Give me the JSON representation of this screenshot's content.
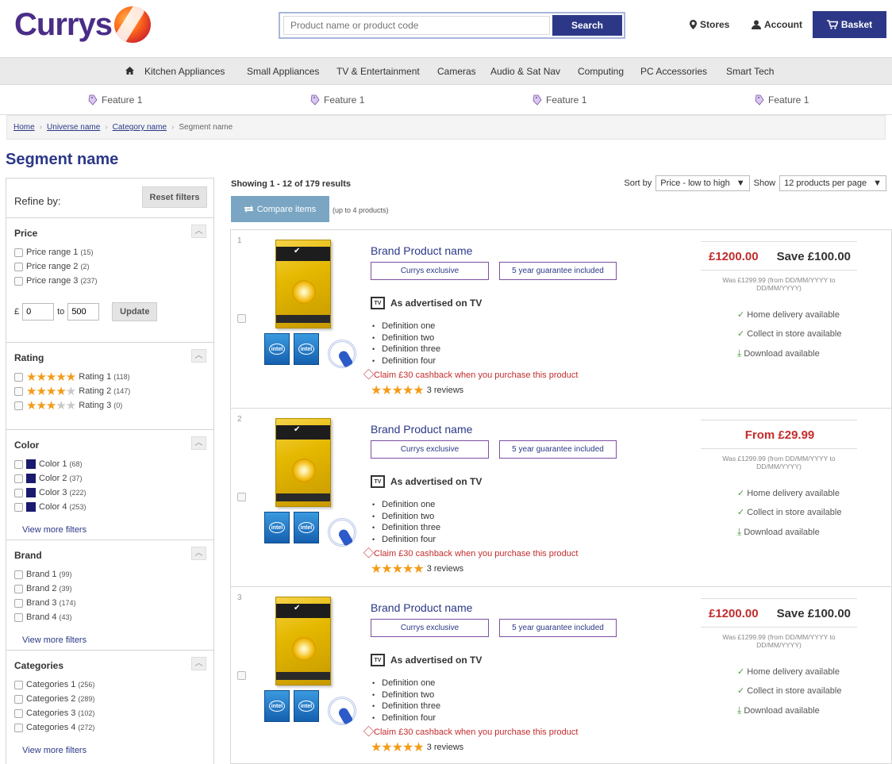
{
  "header": {
    "logo": "Currys",
    "search_placeholder": "Product name or product code",
    "search_button": "Search",
    "stores": "Stores",
    "account": "Account",
    "basket": "Basket"
  },
  "nav": [
    "Kitchen Appliances",
    "Small Appliances",
    "TV & Entertainment",
    "Cameras",
    "Audio & Sat Nav",
    "Computing",
    "PC Accessories",
    "Smart Tech"
  ],
  "features": [
    "Feature 1",
    "Feature 1",
    "Feature 1",
    "Feature 1"
  ],
  "breadcrumb": [
    "Home",
    "Universe name",
    "Category name",
    "Segment name"
  ],
  "page_title": "Segment name",
  "sidebar": {
    "refine_label": "Refine by:",
    "reset_label": "Reset filters",
    "price": {
      "title": "Price",
      "options": [
        {
          "label": "Price range 1",
          "count": "(15)"
        },
        {
          "label": "Price range 2",
          "count": "(2)"
        },
        {
          "label": "Price range 3",
          "count": "(237)"
        }
      ],
      "currency": "£",
      "min": "0",
      "to": "to",
      "max": "500",
      "update": "Update"
    },
    "rating": {
      "title": "Rating",
      "options": [
        {
          "label": "Rating 1",
          "count": "(118)",
          "stars": 5
        },
        {
          "label": "Rating 2",
          "count": "(147)",
          "stars": 4
        },
        {
          "label": "Rating 3",
          "count": "(0)",
          "stars": 3
        }
      ]
    },
    "color": {
      "title": "Color",
      "swatch": "#1a1a6e",
      "options": [
        {
          "label": "Color 1",
          "count": "(68)"
        },
        {
          "label": "Color 2",
          "count": "(37)"
        },
        {
          "label": "Color 3",
          "count": "(222)"
        },
        {
          "label": "Color 4",
          "count": "(253)"
        }
      ],
      "view_more": "View more filters"
    },
    "brand": {
      "title": "Brand",
      "options": [
        {
          "label": "Brand 1",
          "count": "(99)"
        },
        {
          "label": "Brand 2",
          "count": "(39)"
        },
        {
          "label": "Brand 3",
          "count": "(174)"
        },
        {
          "label": "Brand 4",
          "count": "(43)"
        }
      ],
      "view_more": "View more filters"
    },
    "categories": {
      "title": "Categories",
      "options": [
        {
          "label": "Categories 1",
          "count": "(256)"
        },
        {
          "label": "Categories 2",
          "count": "(289)"
        },
        {
          "label": "Categories 3",
          "count": "(102)"
        },
        {
          "label": "Categories 4",
          "count": "(272)"
        }
      ],
      "view_more": "View more filters"
    }
  },
  "results": {
    "showing": "Showing 1 - 12 of 179 results",
    "sort_label": "Sort by",
    "sort_value": "Price - low to high",
    "show_label": "Show",
    "show_value": "12 products per page",
    "compare_button": "Compare items",
    "compare_note": "(up to 4 products)"
  },
  "products": [
    {
      "num": "1",
      "name": "Brand Product name",
      "tag1": "Currys exclusive",
      "tag2": "5 year guarantee included",
      "tv": "As advertised on TV",
      "definitions": [
        "Definition one",
        "Definition two",
        "Definition three",
        "Definition four"
      ],
      "cashback": "Claim £30 cashback when you purchase this product",
      "reviews": "3 reviews",
      "price": "£1200.00",
      "save": "Save £100.00",
      "was": "Was £1299.99 (from DD/MM/YYYY to DD/MM/YYYY)",
      "home_delivery": "Home delivery available",
      "collect": "Collect in store available",
      "download": "Download available"
    },
    {
      "num": "2",
      "name": "Brand Product name",
      "tag1": "Currys exclusive",
      "tag2": "5 year guarantee included",
      "tv": "As advertised on TV",
      "definitions": [
        "Definition one",
        "Definition two",
        "Definition three",
        "Definition four"
      ],
      "cashback": "Claim £30 cashback when you purchase this product",
      "reviews": "3 reviews",
      "price": "From £29.99",
      "save": "",
      "was": "Was £1299.99 (from DD/MM/YYYY to DD/MM/YYYY)",
      "home_delivery": "Home delivery available",
      "collect": "Collect in store available",
      "download": "Download available"
    },
    {
      "num": "3",
      "name": "Brand Product name",
      "tag1": "Currys exclusive",
      "tag2": "5 year guarantee included",
      "tv": "As advertised on TV",
      "definitions": [
        "Definition one",
        "Definition two",
        "Definition three",
        "Definition four"
      ],
      "cashback": "Claim £30 cashback when you purchase this product",
      "reviews": "3 reviews",
      "price": "£1200.00",
      "save": "Save £100.00",
      "was": "Was £1299.99 (from DD/MM/YYYY to DD/MM/YYYY)",
      "home_delivery": "Home delivery available",
      "collect": "Collect in store available",
      "download": "Download available"
    }
  ],
  "colors": {
    "brand": "#2c3887",
    "price_red": "#c32c2c",
    "star": "#f39c1a"
  }
}
